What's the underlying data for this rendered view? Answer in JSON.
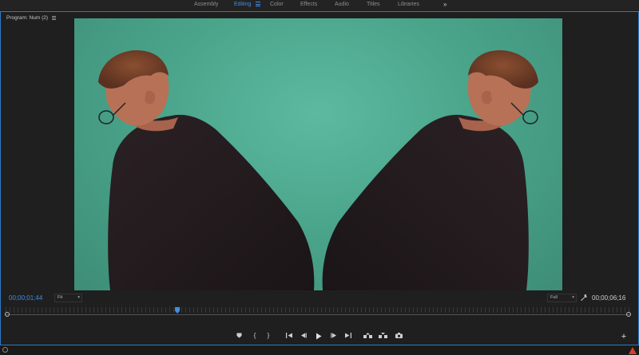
{
  "workspaces": {
    "items": [
      "Assembly",
      "Editing",
      "Color",
      "Effects",
      "Audio",
      "Titles",
      "Libraries"
    ],
    "active": "Editing",
    "more_glyph": "»"
  },
  "monitor": {
    "title": "Program: Num (2)",
    "timecode_current": "00;00;01;44",
    "timecode_duration": "00;00;06;16",
    "zoom": "Fit",
    "resolution": "Full",
    "playhead_fraction": 0.275
  },
  "transport": {
    "buttons": [
      {
        "name": "add-marker-button",
        "icon": "marker-icon"
      },
      {
        "name": "mark-in-button",
        "glyph": "{"
      },
      {
        "name": "mark-out-button",
        "glyph": "}"
      },
      {
        "name": "go-to-in-button",
        "icon": "go-to-in-icon"
      },
      {
        "name": "step-back-button",
        "icon": "step-back-icon"
      },
      {
        "name": "play-button",
        "icon": "play-icon"
      },
      {
        "name": "step-forward-button",
        "icon": "step-forward-icon"
      },
      {
        "name": "go-to-out-button",
        "icon": "go-to-out-icon"
      },
      {
        "name": "lift-button",
        "icon": "lift-icon"
      },
      {
        "name": "extract-button",
        "icon": "extract-icon"
      },
      {
        "name": "export-frame-button",
        "icon": "camera-icon"
      }
    ],
    "add_glyph": "+"
  },
  "colors": {
    "accent": "#3d8ee6",
    "panel_border": "#2d79c7",
    "warning": "#d4402c",
    "green_screen": "#4aa58b"
  }
}
